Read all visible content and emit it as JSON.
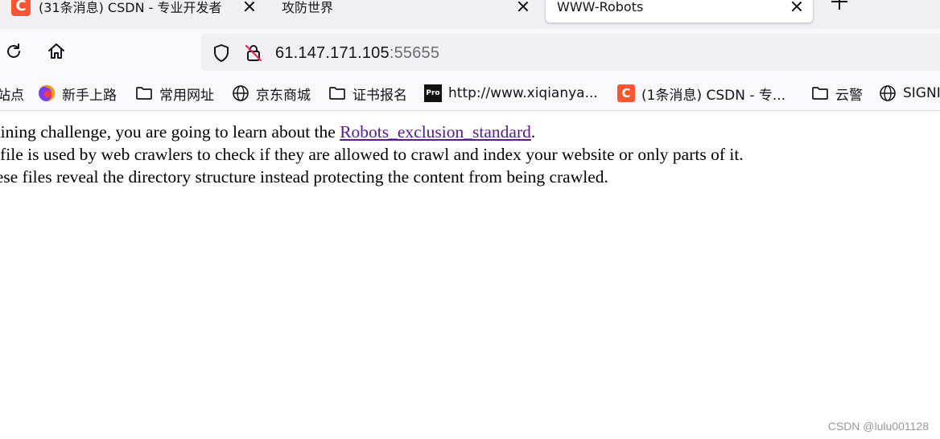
{
  "tabs": [
    {
      "title": "(31条消息) CSDN - 专业开发者",
      "favicon": "csdn-logo",
      "active": false
    },
    {
      "title": "攻防世界",
      "favicon": "none",
      "active": false
    },
    {
      "title": "WWW-Robots",
      "favicon": "none",
      "active": true
    }
  ],
  "nav": {
    "url_host": "61.147.171.105",
    "url_port": ":55655"
  },
  "bookmarks": [
    {
      "label": "站点",
      "icon": "none"
    },
    {
      "label": "新手上路",
      "icon": "firefox-icon"
    },
    {
      "label": "常用网址",
      "icon": "folder-icon"
    },
    {
      "label": "京东商城",
      "icon": "globe-icon"
    },
    {
      "label": "证书报名",
      "icon": "folder-icon"
    },
    {
      "label": "http://www.xiqianya...",
      "icon": "pro-icon",
      "icon_text": "Pro"
    },
    {
      "label": "(1条消息) CSDN - 专...",
      "icon": "csdn-icon"
    },
    {
      "label": "云警",
      "icon": "folder-icon"
    },
    {
      "label": "SIGNI",
      "icon": "globe-icon"
    }
  ],
  "content": {
    "line1_before": "training challenge, you are going to learn about the ",
    "line1_link": "Robots_exclusion_standard",
    "line1_after": ".",
    "line2": "xt file is used by web crawlers to check if they are allowed to crawl and index your website or only parts of it.",
    "line3": "these files reveal the directory structure instead protecting the content from being crawled."
  },
  "watermark": "CSDN @lulu001128",
  "colors": {
    "csdn_brand": "#fc5531",
    "link_visited": "#551a8b",
    "tabstrip_bg": "#f0f0f4"
  }
}
